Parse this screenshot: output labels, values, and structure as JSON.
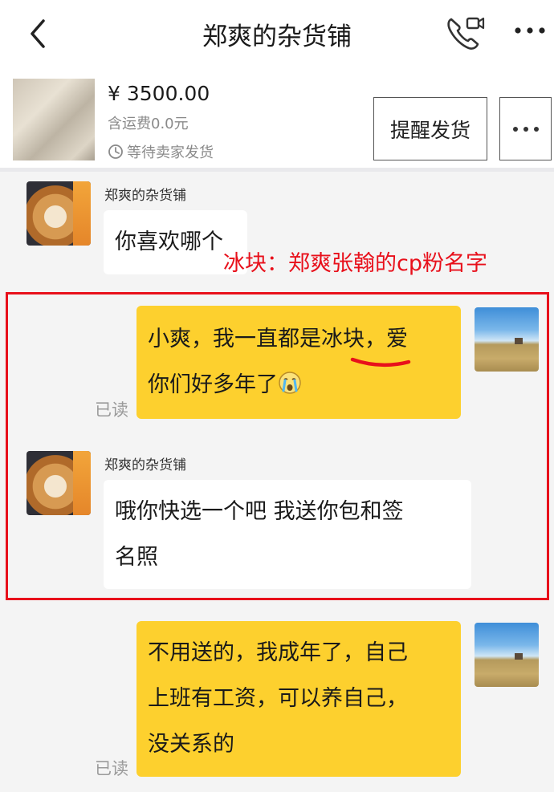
{
  "header": {
    "title": "郑爽的杂货铺",
    "back_icon": "chevron-left-icon",
    "call_icon": "phone-video-icon",
    "more_icon": "more-dots-icon"
  },
  "order": {
    "price": "¥ 3500.00",
    "shipping": "含运费0.0元",
    "status": "等待卖家发货",
    "remind_button": "提醒发货"
  },
  "messages": [
    {
      "sender": "郑爽的杂货铺",
      "text": "你喜欢哪个"
    },
    {
      "line1_before": "小爽，我一直都是",
      "line1_highlight": "冰块",
      "line1_after": "，爱",
      "line2": "你们好多年了",
      "emoji": "crying-face-icon",
      "read": "已读"
    },
    {
      "sender": "郑爽的杂货铺",
      "line1": "哦你快选一个吧 我送你包和签",
      "line2": "名照"
    },
    {
      "line1": "不用送的，我成年了，自己",
      "line2": "上班有工资，可以养自己，",
      "line3": "没关系的",
      "read": "已读"
    }
  ],
  "annotation": {
    "text": "冰块：郑爽张翰的cp粉名字",
    "color": "#e8101b"
  },
  "colors": {
    "bubble_out": "#fdd02e",
    "bubble_in": "#ffffff",
    "background": "#f4f4f4"
  }
}
